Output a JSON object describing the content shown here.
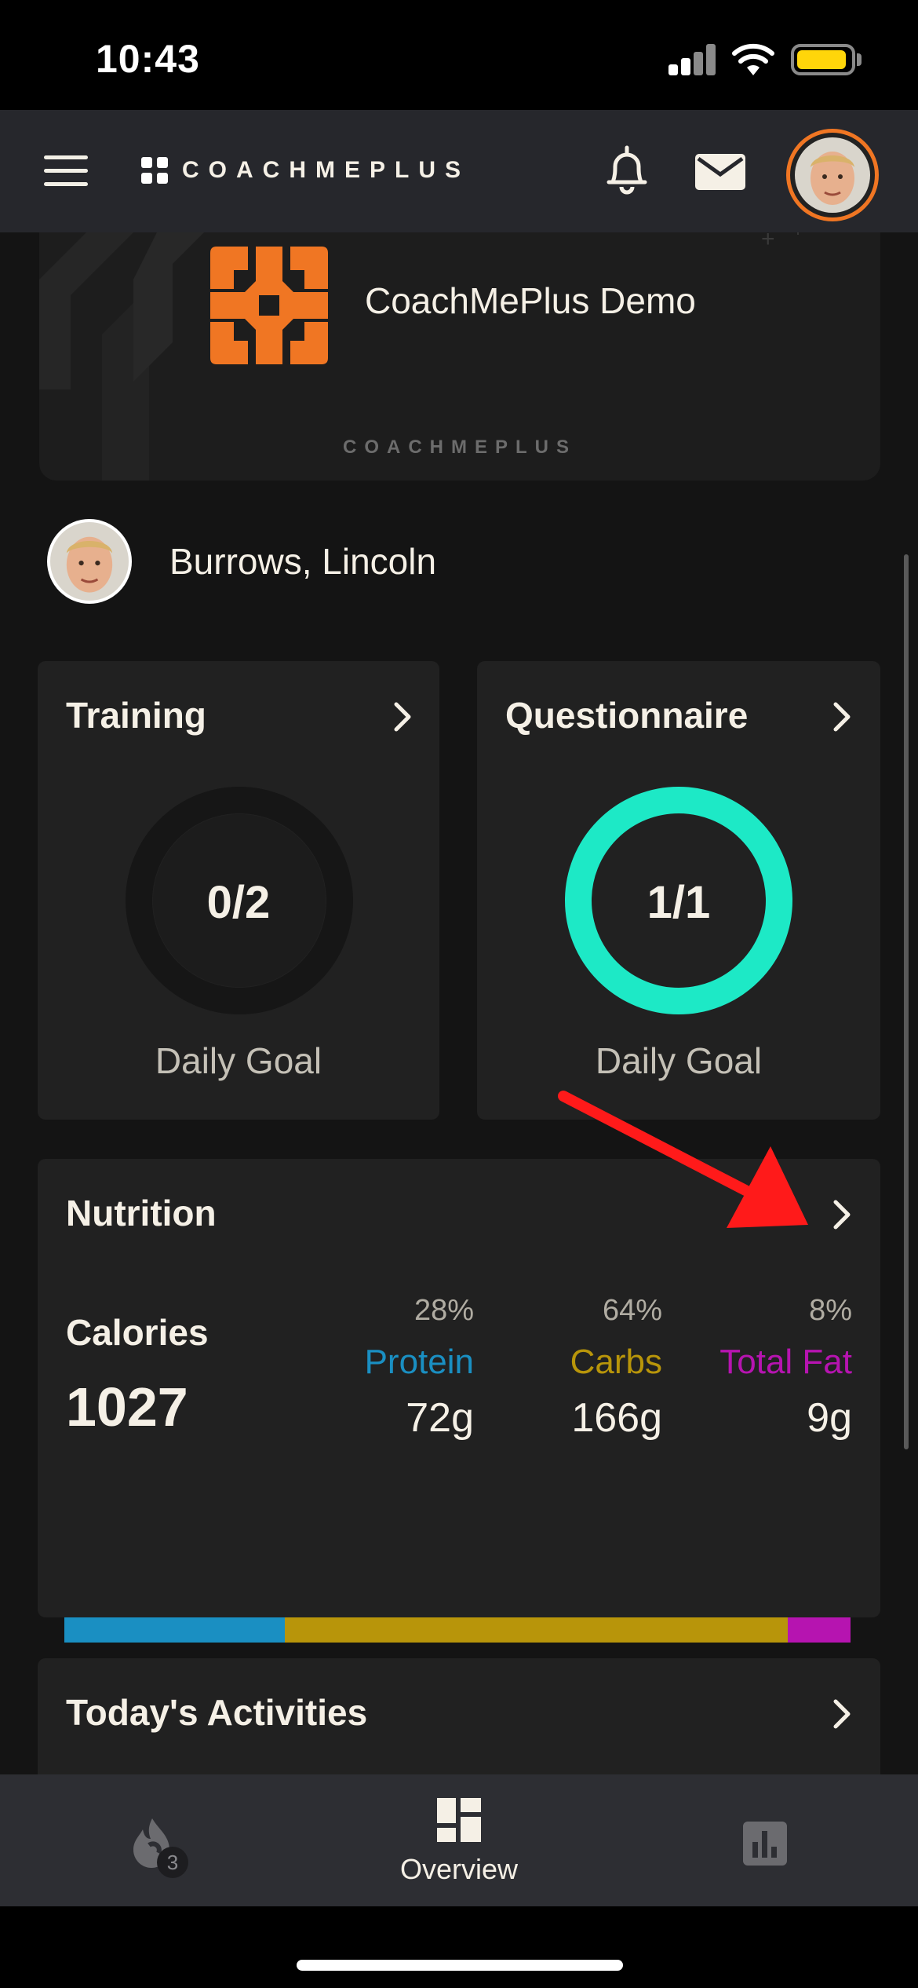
{
  "status_bar": {
    "time": "10:43"
  },
  "header": {
    "logo_text": "COACHMEPLUS",
    "accent_color": "#f07623"
  },
  "team": {
    "name": "CoachMePlus Demo",
    "brand": "COACHMEPLUS"
  },
  "athlete": {
    "name": "Burrows, Lincoln"
  },
  "training": {
    "title": "Training",
    "progress": "0/2",
    "label": "Daily Goal",
    "completion": 0
  },
  "questionnaire": {
    "title": "Questionnaire",
    "progress": "1/1",
    "label": "Daily Goal",
    "completion": 1,
    "ring_color": "#1de9c6"
  },
  "nutrition": {
    "title": "Nutrition",
    "calories_label": "Calories",
    "calories_value": "1027",
    "protein": {
      "pct": "28%",
      "name": "Protein",
      "value": "72g",
      "color": "#1a8fc2",
      "fraction": 0.28
    },
    "carbs": {
      "pct": "64%",
      "name": "Carbs",
      "value": "166g",
      "color": "#b8950a",
      "fraction": 0.64
    },
    "fat": {
      "pct": "8%",
      "name": "Total Fat",
      "value": "9g",
      "color": "#b614b0",
      "fraction": 0.08
    }
  },
  "activities": {
    "title": "Today's Activities"
  },
  "tab_bar": {
    "streak_badge": "3",
    "overview_label": "Overview",
    "icons": [
      "flame-icon",
      "dashboard-icon",
      "bar-chart-icon"
    ]
  }
}
